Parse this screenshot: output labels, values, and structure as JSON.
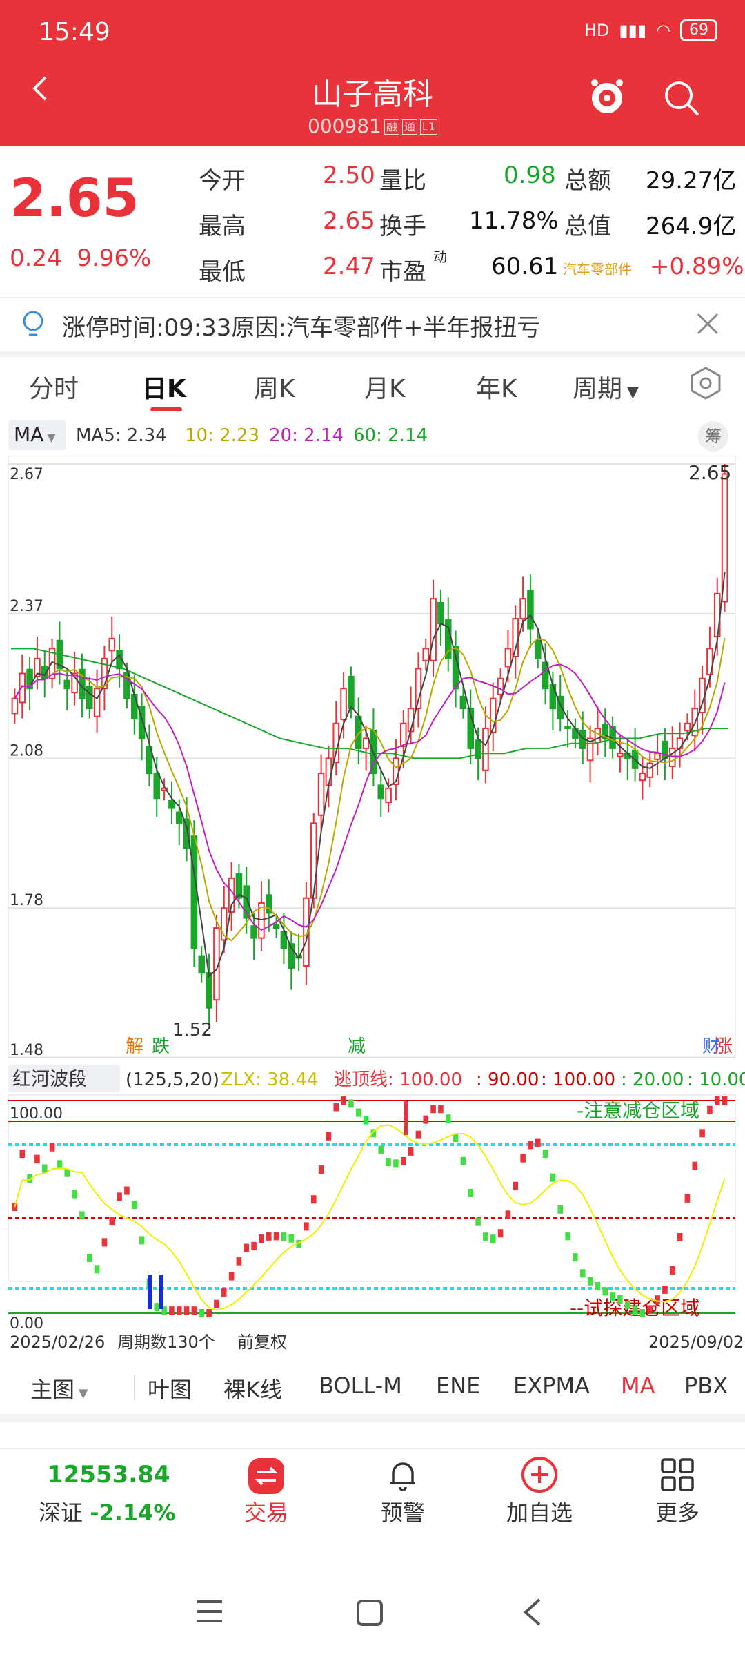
{
  "status": {
    "time": "15:49",
    "battery": "69",
    "network": "HD"
  },
  "header": {
    "title": "山子高科",
    "code": "000981",
    "tag1": "融",
    "tag2": "通",
    "tag3": "L1"
  },
  "quote": {
    "price": "2.65",
    "change": "0.24",
    "pct": "9.96%",
    "rows": [
      {
        "l1": "今开",
        "v1": "2.50",
        "l2": "量比",
        "v2": "0.98",
        "l3": "总额",
        "v3": "29.27亿"
      },
      {
        "l1": "最高",
        "v1": "2.65",
        "l2": "换手",
        "v2": "11.78%",
        "l3": "总值",
        "v3": "264.9亿"
      },
      {
        "l1": "最低",
        "v1": "2.47",
        "l2": "市盈",
        "v2": "60.61",
        "l3": "汽车零部件",
        "v3": "+0.89%"
      }
    ],
    "pe_sup": "动"
  },
  "banner": {
    "text": "涨停时间:09:33原因:汽车零部件+半年报扭亏"
  },
  "tabs": [
    "分时",
    "日K",
    "周K",
    "月K",
    "年K",
    "周期"
  ],
  "ma": {
    "selector": "MA",
    "ma5": "MA5: 2.34",
    "ma10": "10: 2.23",
    "ma20": "20: 2.14",
    "ma60": "60: 2.14",
    "chip": "筹"
  },
  "chart": {
    "y_labels": [
      "2.67",
      "2.37",
      "2.08",
      "1.78",
      "1.48"
    ],
    "high_label": "2.65",
    "low_label": "1.52",
    "events": [
      "解",
      "跌",
      "减",
      "财",
      "涨"
    ],
    "indicator": {
      "name": "红河波段",
      "params": "(125,5,20)",
      "zlx": "ZLX: 38.44",
      "top": "逃顶线: 100.00",
      "l90": ": 90.00",
      "l100": ": 100.00",
      "l20": ": 20.00",
      "l10": ": 10.00",
      "y_top": "100.00",
      "y_bot": "0.00",
      "note_top": "-注意减仓区域",
      "note_bot": "--试探建仓区域"
    },
    "date_start": "2025/02/26",
    "cycles": "周期数130个",
    "adjust": "前复权",
    "date_end": "2025/09/02"
  },
  "chart_data": {
    "type": "candlestick",
    "ylim": [
      1.48,
      2.67
    ],
    "x": [
      "2025/02/26",
      "2025/09/02"
    ],
    "ticks": [
      "2.67",
      "2.37",
      "2.08",
      "1.78",
      "1.48"
    ],
    "close": [
      2.2,
      2.25,
      2.22,
      2.28,
      2.24,
      2.3,
      2.26,
      2.22,
      2.25,
      2.2,
      2.18,
      2.22,
      2.28,
      2.32,
      2.26,
      2.2,
      2.16,
      2.12,
      2.05,
      2.0,
      2.02,
      1.98,
      1.95,
      1.9,
      1.7,
      1.65,
      1.58,
      1.74,
      1.78,
      1.84,
      1.8,
      1.76,
      1.72,
      1.79,
      1.77,
      1.74,
      1.7,
      1.66,
      1.68,
      1.8,
      1.95,
      2.05,
      2.08,
      2.15,
      2.22,
      2.18,
      2.1,
      2.12,
      2.05,
      2.0,
      2.02,
      2.08,
      2.15,
      2.18,
      2.26,
      2.3,
      2.4,
      2.35,
      2.28,
      2.22,
      2.18,
      2.1,
      2.08,
      2.14,
      2.2,
      2.24,
      2.3,
      2.36,
      2.4,
      2.34,
      2.28,
      2.22,
      2.18,
      2.16,
      2.14,
      2.12,
      2.1,
      2.12,
      2.14,
      2.12,
      2.1,
      2.09,
      2.08,
      2.06,
      2.05,
      2.07,
      2.09,
      2.08,
      2.1,
      2.12,
      2.15,
      2.18,
      2.24,
      2.3,
      2.41,
      2.65
    ],
    "ma60": [
      2.3,
      2.3,
      2.29,
      2.28,
      2.27,
      2.26,
      2.24,
      2.22,
      2.2,
      2.18,
      2.16,
      2.14,
      2.12,
      2.11,
      2.1,
      2.1,
      2.09,
      2.09,
      2.08,
      2.08,
      2.08,
      2.09,
      2.09,
      2.1,
      2.1,
      2.11,
      2.11,
      2.12,
      2.12,
      2.13,
      2.13,
      2.14,
      2.14
    ]
  },
  "toolbar": [
    "主图",
    "叶图",
    "裸K线",
    "BOLL-M",
    "ENE",
    "EXPMA",
    "MA",
    "PBX"
  ],
  "nav": {
    "index": "12553.84",
    "index_name": "深证",
    "index_pct": "-2.14%",
    "trade": "交易",
    "alert": "预警",
    "add": "加自选",
    "more": "更多"
  }
}
